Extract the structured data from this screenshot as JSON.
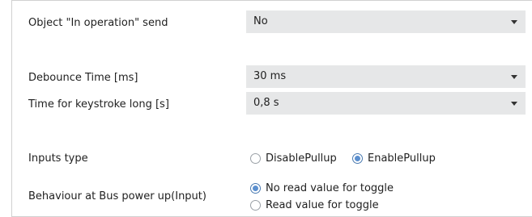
{
  "rows": {
    "in_operation": {
      "label": "Object \"In operation\" send",
      "value": "No"
    },
    "debounce": {
      "label": "Debounce Time [ms]",
      "value": "30 ms"
    },
    "keystroke": {
      "label": "Time for  keystroke long  [s]",
      "value": "0,8 s"
    },
    "inputs_type": {
      "label": "Inputs type",
      "options": [
        {
          "label": "DisablePullup",
          "selected": false
        },
        {
          "label": "EnablePullup",
          "selected": true
        }
      ]
    },
    "bus_power_up": {
      "label": "Behaviour at Bus power up(Input)",
      "options": [
        {
          "label": "No read value for toggle",
          "selected": true
        },
        {
          "label": "Read value for toggle",
          "selected": false
        }
      ]
    }
  },
  "icons": {
    "dropdown_arrow": "chevron-down-icon",
    "radio": "radio-button-icon"
  },
  "colors": {
    "field_bg": "#e6e7e8",
    "radio_selected": "#5b8fcf",
    "border": "#d0d0d0"
  }
}
